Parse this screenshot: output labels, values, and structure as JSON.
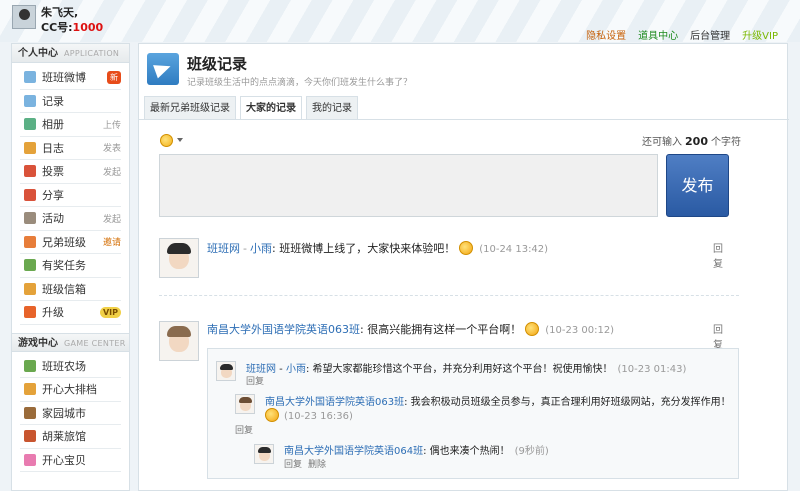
{
  "user": {
    "name": "朱飞天,",
    "cc_label": "CC号:",
    "cc_value": "1000"
  },
  "top_links": [
    "隐私设置",
    "道具中心",
    "后台管理",
    "升级VIP"
  ],
  "sidebar": {
    "section1": {
      "title": "个人中心",
      "subtitle": "APPLICATION"
    },
    "items": [
      {
        "label": "班班微博",
        "extra": "新",
        "icon_color": "#7ab3df",
        "badge": "new"
      },
      {
        "label": "记录",
        "extra": "",
        "icon_color": "#7ab3df"
      },
      {
        "label": "相册",
        "extra": "上传",
        "icon_color": "#5bb085"
      },
      {
        "label": "日志",
        "extra": "发表",
        "icon_color": "#e4a23a"
      },
      {
        "label": "投票",
        "extra": "发起",
        "icon_color": "#d9523a"
      },
      {
        "label": "分享",
        "extra": "",
        "icon_color": "#d9523a"
      },
      {
        "label": "活动",
        "extra": "发起",
        "icon_color": "#9a8c7c"
      },
      {
        "label": "兄弟班级",
        "extra": "邀请",
        "icon_color": "#e77d3a",
        "badge": "invite"
      },
      {
        "label": "有奖任务",
        "extra": "",
        "icon_color": "#6aa84f"
      },
      {
        "label": "班级信箱",
        "extra": "",
        "icon_color": "#e4a23a"
      },
      {
        "label": "升级",
        "extra": "VIP",
        "icon_color": "#e7632a",
        "badge": "vip"
      }
    ],
    "section2": {
      "title": "游戏中心",
      "subtitle": "GAME CENTER"
    },
    "games": [
      {
        "label": "班班农场",
        "icon_color": "#6aa84f"
      },
      {
        "label": "开心大排档",
        "icon_color": "#e4a23a"
      },
      {
        "label": "家园城市",
        "icon_color": "#9a6b3a"
      },
      {
        "label": "胡莱旅馆",
        "icon_color": "#c8552f"
      },
      {
        "label": "开心宝贝",
        "icon_color": "#e87bb0"
      }
    ]
  },
  "page": {
    "title": "班级记录",
    "subtitle": "记录班级生活中的点点滴滴，今天你们班发生什么事了？",
    "tabs": [
      "最新兄弟班级记录",
      "大家的记录",
      "我的记录"
    ],
    "active_tab": 1
  },
  "composer": {
    "remaining_prefix": "还可输入",
    "remaining_count": "200",
    "remaining_suffix": "个字符",
    "publish_label": "发布"
  },
  "posts": [
    {
      "author": "班班网",
      "sub_author": "小雨",
      "text": "班班微博上线了，大家快来体验吧！",
      "time": "(10-24 13:42)",
      "reply": "回复"
    },
    {
      "author": "南昌大学外国语学院英语063班",
      "text": "很高兴能拥有这样一个平台啊！",
      "time": "(10-23 00:12)",
      "reply": "回复"
    }
  ],
  "thread": [
    {
      "author": "班班网",
      "sub_author": "小雨",
      "text": "希望大家都能珍惜这个平台，并充分利用好这个平台！祝使用愉快！",
      "time": "(10-23 01:43)",
      "actions": [
        "回复"
      ]
    },
    {
      "author": "南昌大学外国语学院英语063班",
      "text": "我会积极动员班级全员参与，真正合理利用好班级网站，充分发挥作用！",
      "time": "(10-23 16:36)",
      "actions": [
        "回复"
      ]
    },
    {
      "author": "南昌大学外国语学院英语064班",
      "text": "偶也来凑个热闹！",
      "time": "(9秒前)",
      "actions": [
        "回复",
        "删除"
      ]
    }
  ]
}
